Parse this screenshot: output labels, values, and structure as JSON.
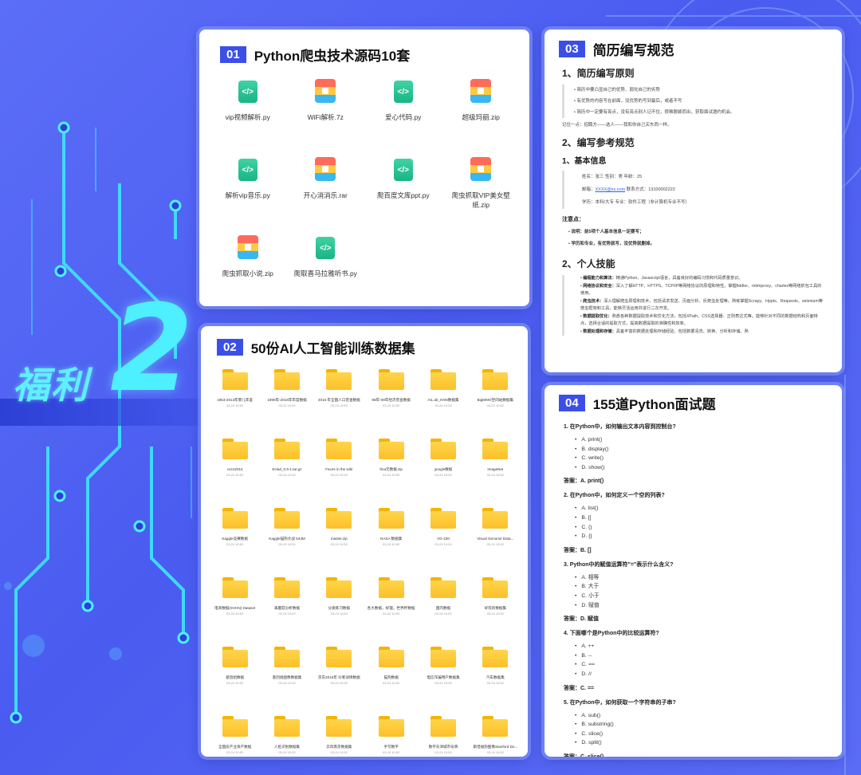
{
  "promo": {
    "label": "福利",
    "number": "2"
  },
  "colors": {
    "background": "#5062f2",
    "accent": "#3b4fe8",
    "promo_text": "#4ef0ff",
    "folder": "#fcc02a",
    "code_file": "#19b486"
  },
  "card1": {
    "badge": "01",
    "title": "Python爬虫技术源码10套",
    "files": [
      {
        "name": "vip视频解析.py",
        "icon": "code-file-icon"
      },
      {
        "name": "WiFi解析.7z",
        "icon": "zip-archive-icon"
      },
      {
        "name": "爱心代码.py",
        "icon": "code-file-icon"
      },
      {
        "name": "超级玛丽.zip",
        "icon": "zip-archive-icon"
      },
      {
        "name": "解析vip音乐.py",
        "icon": "code-file-icon"
      },
      {
        "name": "开心消消乐.rar",
        "icon": "zip-archive-icon"
      },
      {
        "name": "爬百度文库ppt.py",
        "icon": "code-file-icon"
      },
      {
        "name": "爬虫抓取VIP美女壁纸.zip",
        "icon": "zip-archive-icon"
      },
      {
        "name": "爬虫抓取小说.zip",
        "icon": "zip-archive-icon"
      },
      {
        "name": "爬取喜马拉雅听书.py",
        "icon": "code-file-icon"
      }
    ]
  },
  "card2": {
    "badge": "02",
    "title": "50份AI人工智能训练数据集",
    "folders": [
      {
        "name": "1953-2013年婴儿年鉴",
        "date": "03-24 10:52"
      },
      {
        "name": "1990年-2016年年度数据",
        "date": "03-24 10:52"
      },
      {
        "name": "2015 年全国人口普查数据",
        "date": "03-24 10:52"
      },
      {
        "name": "98年-09年经济普查数据",
        "date": "03-24 10:52"
      },
      {
        "name": "AIL.ab_KNN数据集",
        "date": "03-24 10:52"
      },
      {
        "name": "BigMMO空间站数据集",
        "date": "03-24 10:52"
      },
      {
        "name": "coco2014",
        "date": "03-24 10:52"
      },
      {
        "name": "Eclad_0.5-1.tar.gz",
        "date": "03-24 10:52"
      },
      {
        "name": "Faces in the wild",
        "date": "03-24 10:52"
      },
      {
        "name": "fma元数据.zip",
        "date": "03-24 10:52"
      },
      {
        "name": "google数据",
        "date": "03-24 10:52"
      },
      {
        "name": "ImageNet",
        "date": "03-24 10:52"
      },
      {
        "name": "Kaggle竞赛数据",
        "date": "03-24 10:52"
      },
      {
        "name": "Kaggle猫狗大战 543M",
        "date": "03-24 10:52"
      },
      {
        "name": "master.zip",
        "date": "03-24 10:52"
      },
      {
        "name": "NASA 数据集",
        "date": "03-24 10:52"
      },
      {
        "name": "VG-100",
        "date": "03-24 10:52"
      },
      {
        "name": "Visual Genome Data...",
        "date": "03-24 10:52"
      },
      {
        "name": "电商数据(SVHN) Dataset",
        "date": "03-24 10:52"
      },
      {
        "name": "毒蘑菇分析数据",
        "date": "03-24 10:52"
      },
      {
        "name": "分类练习数据",
        "date": "03-24 10:52"
      },
      {
        "name": "各大数据，好理，世界杯数据集",
        "date": "03-24 10:52"
      },
      {
        "name": "国内数据",
        "date": "03-24 10:52"
      },
      {
        "name": "好玩的数据集",
        "date": "03-24 10:52"
      },
      {
        "name": "基因组数据",
        "date": "03-24 10:52"
      },
      {
        "name": "基因组图像数据集",
        "date": "03-24 10:52"
      },
      {
        "name": "京东2015年 众筹详情数据",
        "date": "03-24 10:52"
      },
      {
        "name": "猫狗数据",
        "date": "03-24 10:52"
      },
      {
        "name": "电信诈骗用户数据集",
        "date": "03-24 10:52"
      },
      {
        "name": "汽车数据集",
        "date": "03-24 10:52"
      },
      {
        "name": "全国房产业资产数据",
        "date": "03-24 10:52"
      },
      {
        "name": "人脸识别数据集",
        "date": "03-24 10:52"
      },
      {
        "name": "云风南京数据集",
        "date": "03-24 10:52"
      },
      {
        "name": "手写数字",
        "date": "03-24 10:52"
      },
      {
        "name": "数字天津城市号牌",
        "date": "03-24 10:52"
      },
      {
        "name": "斯坦福狗图像Stanford Do...",
        "date": "03-24 10:52"
      }
    ]
  },
  "card3": {
    "badge": "03",
    "title": "简历编写规范",
    "section1_title": "1、简历编写原则",
    "principles": [
      "简历中要凸显自己的优势、弱化自己的劣势",
      "有优势的内容写在前面，没优势的写到最后，或者不写",
      "简历中一定要有亮点，没有亮点别人记不住，很难脱颖而出，获取面试邀约机会。"
    ],
    "note": "记住一点：招聘方——选人——我和你自己买东西一样。",
    "section2_title": "2、编写参考规范",
    "basic_title": "1、基本信息",
    "basic_line1": "姓名：张三 性别：男 年龄：25",
    "email_label": "邮箱：",
    "email_value": "XXXX@xx.com",
    "phone_text": " 联系方式：13100002222",
    "basic_line3": "学历：本科/大专 专业：软件工程（非计算机专业不写）",
    "notice_title": "注意点：",
    "notices": [
      "说明：前5项个人基本信息一定要写；",
      "学历和专业，有优势就写，没优势就删掉。"
    ],
    "skills_title": "2、个人技能",
    "skills": [
      {
        "head": "编程能力和算法：",
        "text": "精通Python、Javascript语言，具备良好的编码习惯和代码质量意识。"
      },
      {
        "head": "网络协议和安全：",
        "text": "深入了解HTTP、HTTPS、TCP/IP等网络协议的原理和特性。掌握fiddler、mitmproxy、charles等网络抓包工具的使用。"
      },
      {
        "head": "爬虫技术：",
        "text": "深入理解爬虫原理和技术，包括请求发送、页面分析、反爬虫处理等。熟练掌握Scrapy、Hpptx、Requests、selenium等爬虫框架和工具，能够灵活运用并进行二次开发。"
      },
      {
        "head": "数据提取优化：",
        "text": "熟悉各种数据提取技术和优化方法，包括XPath、CSS选择器、正则表达式等。能够针对不同的数据结构和页面特点，选择合适的提取方式，提高数据提取的准确性和效率。"
      },
      {
        "head": "数据处理和存储：",
        "text": "具备丰富的数据处理和存储经验，包括数据清洗、转换、分析和存储。熟"
      }
    ]
  },
  "card4": {
    "badge": "04",
    "title": "155道Python面试题",
    "questions": [
      {
        "q": "1. 在Python中，如何输出文本内容到控制台?",
        "options": [
          "A. print()",
          "B. display()",
          "C. write()",
          "D. show()"
        ],
        "answer": "答案：A. print()"
      },
      {
        "q": "2. 在Python中，如何定义一个空的列表?",
        "options": [
          "A. list()",
          "B. []",
          "C. ()",
          "D. {}"
        ],
        "answer": "答案：B. []"
      },
      {
        "q": "3. Python中的赋值运算符\"=\"表示什么含义?",
        "options": [
          "A. 相等",
          "B. 大于",
          "C. 小于",
          "D. 赋值"
        ],
        "answer": "答案：D. 赋值"
      },
      {
        "q": "4. 下面哪个是Python中的比较运算符?",
        "options": [
          "A. ++",
          "B. --",
          "C. ==",
          "D. //"
        ],
        "answer": "答案：C. =="
      },
      {
        "q": "5. 在Python中，如何获取一个字符串的子串?",
        "options": [
          "A. sub()",
          "B. substring()",
          "C. slice()",
          "D. split()"
        ],
        "answer": "答案：C. slice()"
      }
    ]
  }
}
